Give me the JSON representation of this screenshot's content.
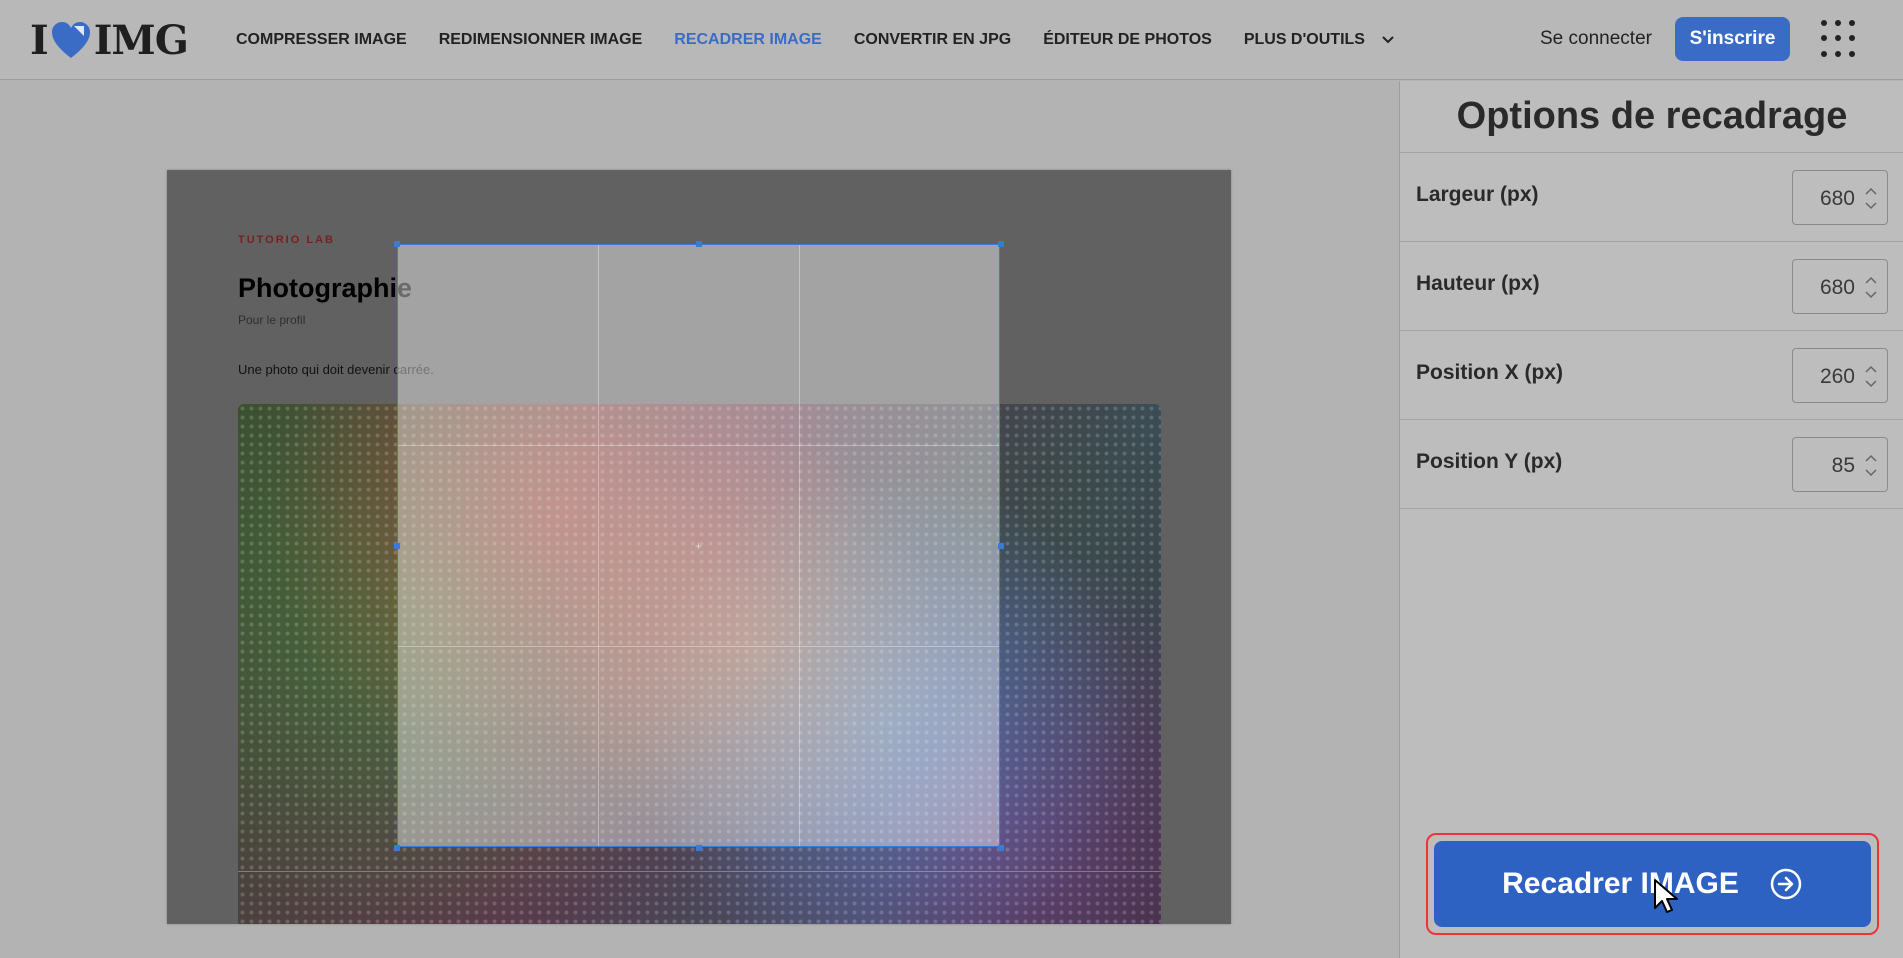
{
  "logo": {
    "left": "I",
    "right": "IMG"
  },
  "nav": [
    {
      "label": "COMPRESSER IMAGE",
      "active": false
    },
    {
      "label": "REDIMENSIONNER IMAGE",
      "active": false
    },
    {
      "label": "RECADRER IMAGE",
      "active": true
    },
    {
      "label": "CONVERTIR EN JPG",
      "active": false
    },
    {
      "label": "ÉDITEUR DE PHOTOS",
      "active": false
    },
    {
      "label": "PLUS D'OUTILS",
      "active": false
    }
  ],
  "header": {
    "login": "Se connecter",
    "signup": "S'inscrire"
  },
  "document": {
    "brand": "TUTORIO LAB",
    "title": "Photographie",
    "subtitle": "Pour le profil",
    "text": "Une photo qui doit devenir carrée."
  },
  "panel": {
    "title": "Options de recadrage",
    "options": [
      {
        "label": "Largeur (px)",
        "value": "680"
      },
      {
        "label": "Hauteur (px)",
        "value": "680"
      },
      {
        "label": "Position X (px)",
        "value": "260"
      },
      {
        "label": "Position Y (px)",
        "value": "85"
      }
    ],
    "crop_button": "Recadrer IMAGE"
  },
  "colors": {
    "accent": "#3a6cc6",
    "button": "#2e62c2",
    "highlight": "#ee3333"
  }
}
